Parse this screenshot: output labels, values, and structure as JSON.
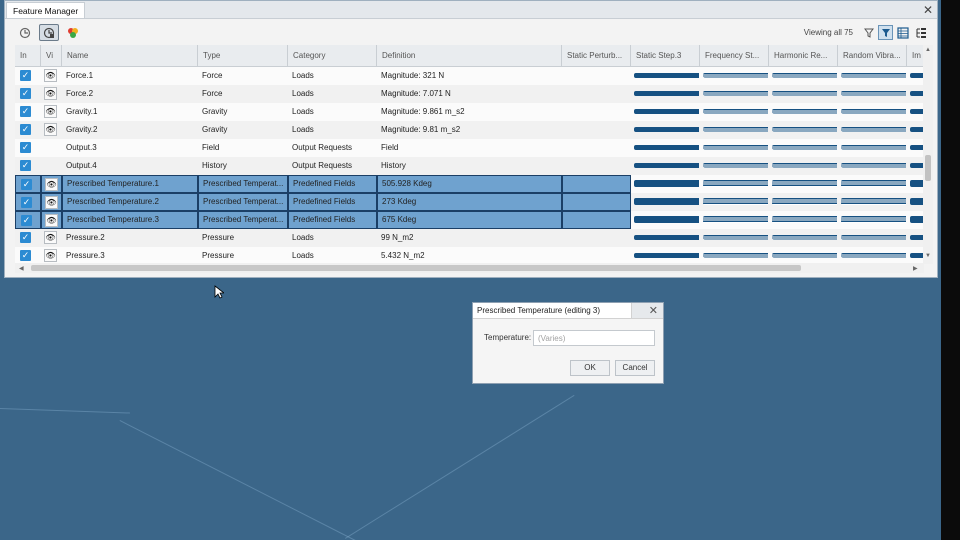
{
  "window": {
    "title": "Feature Manager",
    "close_glyph": "✕",
    "viewing_text": "Viewing all 75"
  },
  "toolbar": {
    "left_icons": [
      "feature-tree-icon",
      "feature-add-icon",
      "color-palette-icon"
    ],
    "right_icons": [
      "filter-icon",
      "filter-active-icon",
      "table-view-icon",
      "tree-view-icon"
    ]
  },
  "table": {
    "columns": [
      "In",
      "Vi",
      "Name",
      "Type",
      "Category",
      "Definition",
      "Static Perturb...",
      "Static Step.3",
      "Frequency St...",
      "Harmonic Re...",
      "Random Vibra...",
      "Im"
    ],
    "rows": [
      {
        "name": "Force.1",
        "type": "Force",
        "category": "Loads",
        "definition": "Magnitude: 321 N",
        "eye": true,
        "selected": false
      },
      {
        "name": "Force.2",
        "type": "Force",
        "category": "Loads",
        "definition": "Magnitude: 7.071 N",
        "eye": true,
        "selected": false
      },
      {
        "name": "Gravity.1",
        "type": "Gravity",
        "category": "Loads",
        "definition": "Magnitude: 9.861 m_s2",
        "eye": true,
        "selected": false
      },
      {
        "name": "Gravity.2",
        "type": "Gravity",
        "category": "Loads",
        "definition": "Magnitude: 9.81 m_s2",
        "eye": true,
        "selected": false
      },
      {
        "name": "Output.3",
        "type": "Field",
        "category": "Output Requests",
        "definition": "Field",
        "eye": false,
        "selected": false
      },
      {
        "name": "Output.4",
        "type": "History",
        "category": "Output Requests",
        "definition": "History",
        "eye": false,
        "selected": false
      },
      {
        "name": "Prescribed Temperature.1",
        "type": "Prescribed Temperat...",
        "category": "Predefined Fields",
        "definition": "505.928 Kdeg",
        "eye": true,
        "selected": true
      },
      {
        "name": "Prescribed Temperature.2",
        "type": "Prescribed Temperat...",
        "category": "Predefined Fields",
        "definition": "273 Kdeg",
        "eye": true,
        "selected": true
      },
      {
        "name": "Prescribed Temperature.3",
        "type": "Prescribed Temperat...",
        "category": "Predefined Fields",
        "definition": "675 Kdeg",
        "eye": true,
        "selected": true
      },
      {
        "name": "Pressure.2",
        "type": "Pressure",
        "category": "Loads",
        "definition": "99 N_m2",
        "eye": true,
        "selected": false
      },
      {
        "name": "Pressure.3",
        "type": "Pressure",
        "category": "Loads",
        "definition": "5.432 N_m2",
        "eye": true,
        "selected": false
      }
    ]
  },
  "dialog": {
    "title": "Prescribed Temperature (editing 3)",
    "close_glyph": "✕",
    "field_label": "Temperature:",
    "field_placeholder": "(Varies)",
    "ok_label": "OK",
    "cancel_label": "Cancel"
  },
  "colors": {
    "desktop": "#3b6689",
    "selection": "#6fa2cf",
    "bar": "#165182",
    "checkbox": "#2c8bd2"
  }
}
